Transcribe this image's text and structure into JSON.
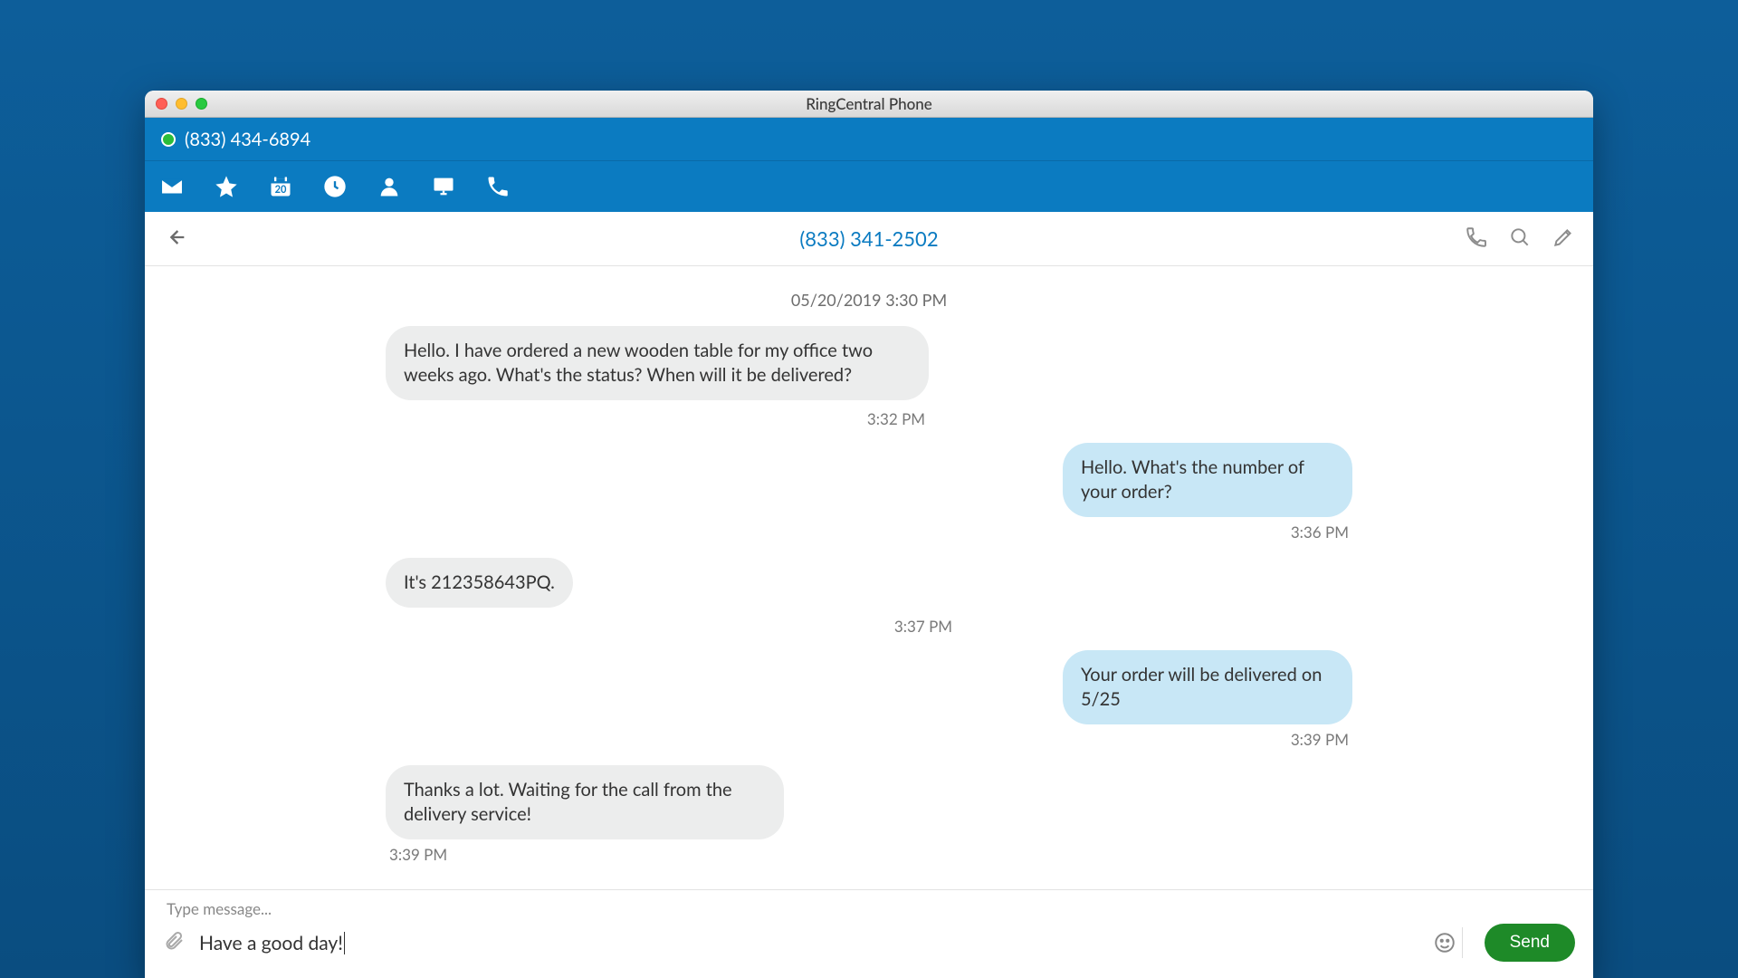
{
  "window": {
    "title": "RingCentral Phone"
  },
  "status": {
    "phone": "(833) 434-6894"
  },
  "nav": {
    "calendar_day": "20"
  },
  "conversation": {
    "contact_number": "(833) 341-2502",
    "date_header": "05/20/2019 3:30 PM",
    "messages": [
      {
        "side": "incoming",
        "text": "Hello. I have ordered a new wooden table for my office two weeks ago. What's the status? When will it be delivered?",
        "time": "3:32 PM",
        "time_pos": "center"
      },
      {
        "side": "outgoing",
        "text": "Hello. What's the number of your order?",
        "time": "3:36 PM",
        "time_pos": "right"
      },
      {
        "side": "incoming",
        "text": "It's 212358643PQ.",
        "time": "3:37 PM",
        "time_pos": "center"
      },
      {
        "side": "outgoing",
        "text": "Your order will be delivered on 5/25",
        "time": "3:39 PM",
        "time_pos": "right"
      },
      {
        "side": "incoming",
        "text": "Thanks a lot. Waiting for the call from the delivery service!",
        "time": "3:39 PM",
        "time_pos": "left"
      }
    ]
  },
  "composer": {
    "label": "Type message...",
    "value": "Have a good day!",
    "send_label": "Send"
  }
}
